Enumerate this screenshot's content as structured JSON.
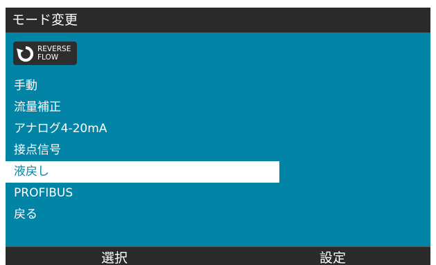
{
  "title": "モード変更",
  "badge": {
    "icon": "reverse-flow-icon",
    "line1": "REVERSE",
    "line2": "FLOW"
  },
  "menu": {
    "selected_index": 4,
    "items": [
      {
        "label": "手動"
      },
      {
        "label": "流量補正"
      },
      {
        "label": "アナログ4-20mA"
      },
      {
        "label": "接点信号"
      },
      {
        "label": "液戻し"
      },
      {
        "label": "PROFIBUS"
      },
      {
        "label": "戻る"
      }
    ]
  },
  "softkeys": {
    "left": "選択",
    "right": "設定"
  },
  "colors": {
    "background": "#0284a6",
    "bar": "#2a2a2a",
    "selected_bg": "#ffffff",
    "selected_text": "#0284a6",
    "text": "#ffffff"
  }
}
